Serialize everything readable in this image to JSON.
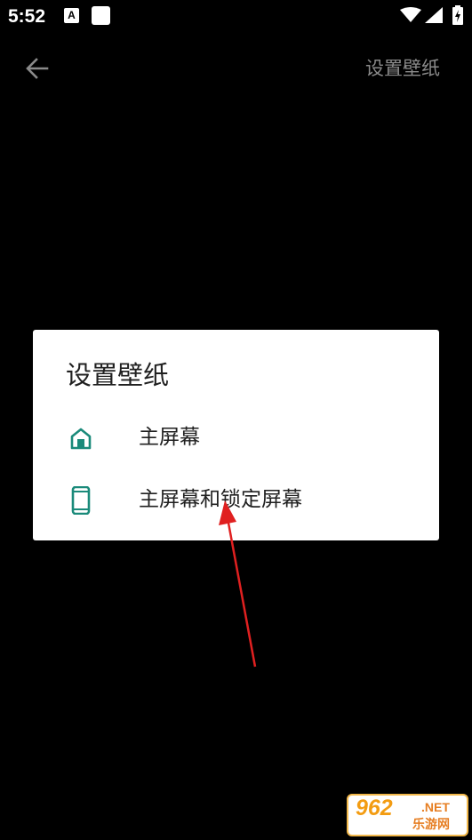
{
  "status_bar": {
    "time": "5:52",
    "notification_letter": "A",
    "icons": [
      "wifi-icon",
      "signal-icon",
      "battery-charging-icon"
    ]
  },
  "toolbar": {
    "back_icon": "back-arrow-icon",
    "title": "设置壁纸"
  },
  "dialog": {
    "title": "设置壁纸",
    "options": [
      {
        "icon": "home-icon",
        "label": "主屏幕"
      },
      {
        "icon": "phone-icon",
        "label": "主屏幕和锁定屏幕"
      }
    ]
  },
  "colors": {
    "background": "#000000",
    "dialog_background": "#ffffff",
    "icon_accent": "#1a8a7a",
    "annotation": "#e02020"
  },
  "watermark": {
    "brand": "962",
    "suffix": ".NET",
    "sub": "乐游网"
  }
}
